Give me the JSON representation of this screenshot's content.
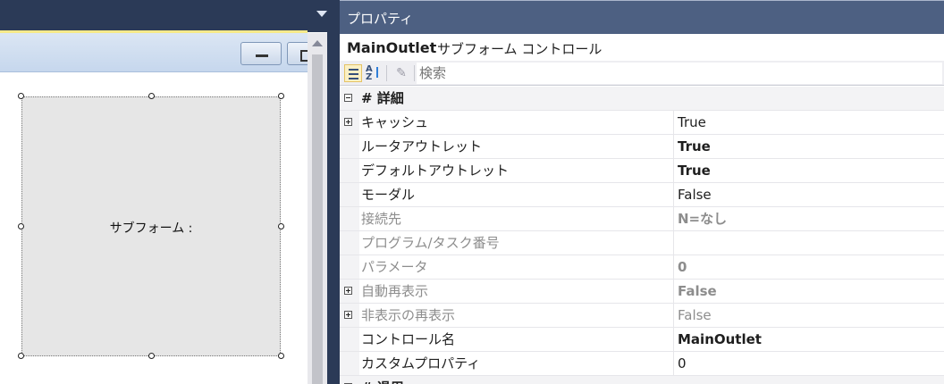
{
  "designer": {
    "subform_label": "サブフォーム :"
  },
  "properties": {
    "panel_title": "プロパティ",
    "object_name": "MainOutlet",
    "object_type": "サブフォーム コントロール",
    "search_placeholder": "検索",
    "category_detail": "# 詳細",
    "category_next": "# 退用",
    "rows": [
      {
        "name": "キャッシュ",
        "value": "True",
        "expandable": true,
        "bold": false,
        "disabled": false
      },
      {
        "name": "ルータアウトレット",
        "value": "True",
        "expandable": false,
        "bold": true,
        "disabled": false
      },
      {
        "name": "デフォルトアウトレット",
        "value": "True",
        "expandable": false,
        "bold": true,
        "disabled": false
      },
      {
        "name": "モーダル",
        "value": "False",
        "expandable": false,
        "bold": false,
        "disabled": false
      },
      {
        "name": "接続先",
        "value": "N=なし",
        "expandable": false,
        "bold": true,
        "disabled": true
      },
      {
        "name": "プログラム/タスク番号",
        "value": "",
        "expandable": false,
        "bold": false,
        "disabled": true
      },
      {
        "name": "パラメータ",
        "value": "0",
        "expandable": false,
        "bold": true,
        "disabled": true
      },
      {
        "name": "自動再表示",
        "value": "False",
        "expandable": true,
        "bold": true,
        "disabled": true
      },
      {
        "name": "非表示の再表示",
        "value": "False",
        "expandable": true,
        "bold": false,
        "disabled": true
      },
      {
        "name": "コントロール名",
        "value": "MainOutlet",
        "expandable": false,
        "bold": true,
        "disabled": false
      },
      {
        "name": "カスタムプロパティ",
        "value": "0",
        "expandable": false,
        "bold": false,
        "disabled": false
      }
    ]
  },
  "icons": {
    "categorized": "categorized-view-icon",
    "alphabetical": "alphabetical-sort-icon",
    "property_pages": "wrench-icon"
  }
}
